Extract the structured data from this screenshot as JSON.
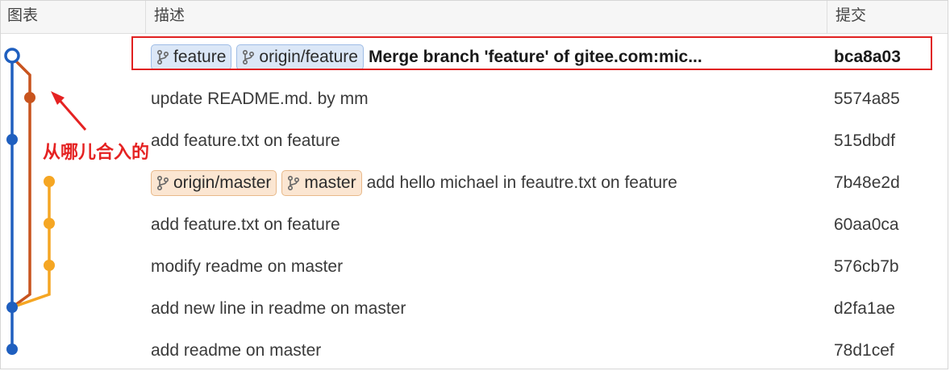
{
  "header": {
    "graph": "图表",
    "description": "描述",
    "commit": "提交"
  },
  "annotation": "从哪儿合入的",
  "colors": {
    "main_line": "#1f5fbf",
    "merge_line": "#c8541e",
    "feature_line": "#f5a623",
    "highlight": "#e02020"
  },
  "icons": {
    "branch": "branch-icon",
    "arrow": "arrow-icon"
  },
  "commits": [
    {
      "tags": [
        {
          "label": "feature",
          "style": "blue"
        },
        {
          "label": "origin/feature",
          "style": "blue"
        }
      ],
      "message": "Merge branch 'feature' of gitee.com:mic...",
      "hash": "bca8a03",
      "bold": true
    },
    {
      "tags": [],
      "message": "update README.md. by mm",
      "hash": "5574a85",
      "bold": false
    },
    {
      "tags": [],
      "message": "add feature.txt on feature",
      "hash": "515dbdf",
      "bold": false
    },
    {
      "tags": [
        {
          "label": "origin/master",
          "style": "orange"
        },
        {
          "label": "master",
          "style": "orange"
        }
      ],
      "message": "add hello michael in feautre.txt on feature",
      "hash": "7b48e2d",
      "bold": false
    },
    {
      "tags": [],
      "message": "add feature.txt on feature",
      "hash": "60aa0ca",
      "bold": false
    },
    {
      "tags": [],
      "message": "modify readme on master",
      "hash": "576cb7b",
      "bold": false
    },
    {
      "tags": [],
      "message": "add new line in readme on master",
      "hash": "d2fa1ae",
      "bold": false
    },
    {
      "tags": [],
      "message": "add readme on master",
      "hash": "78d1cef",
      "bold": false
    }
  ]
}
